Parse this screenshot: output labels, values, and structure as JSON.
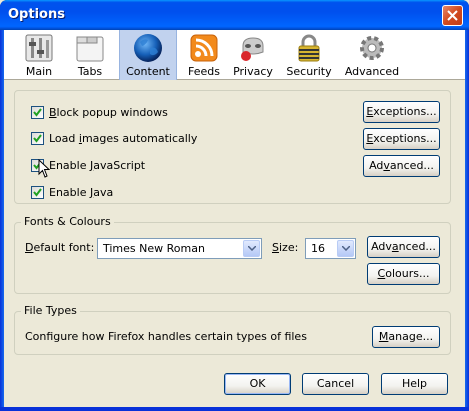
{
  "window": {
    "title": "Options"
  },
  "panes": [
    {
      "id": "main",
      "label": "Main",
      "icon": "main-settings-icon"
    },
    {
      "id": "tabs",
      "label": "Tabs",
      "icon": "tabs-icon"
    },
    {
      "id": "content",
      "label": "Content",
      "icon": "globe-icon",
      "selected": true
    },
    {
      "id": "feeds",
      "label": "Feeds",
      "icon": "feed-icon"
    },
    {
      "id": "privacy",
      "label": "Privacy",
      "icon": "privacy-mask-icon"
    },
    {
      "id": "security",
      "label": "Security",
      "icon": "padlock-icon"
    },
    {
      "id": "advanced",
      "label": "Advanced",
      "icon": "gear-icon"
    }
  ],
  "content": {
    "checkboxes": [
      {
        "label_u": "B",
        "label_rest": "lock popup windows",
        "checked": true,
        "button": "Exceptions...",
        "button_u": "E",
        "button_rest": "xceptions..."
      },
      {
        "label_pre": "Load ",
        "label_u": "i",
        "label_rest": "mages automatically",
        "checked": true,
        "button_u": "E",
        "button_rest": "xceptions..."
      },
      {
        "label_pre": "Enable ",
        "label_u": "J",
        "label_rest": "avaScript",
        "checked": true,
        "button_pre": "Ad",
        "button_u": "v",
        "button_rest": "anced..."
      },
      {
        "label_pre": "Enable ",
        "label_u": "J",
        "label_rest": "ava",
        "checked": true
      }
    ],
    "fonts": {
      "group_title": "Fonts & Colours",
      "default_font_label_pre": "",
      "default_font_label_u": "D",
      "default_font_label_rest": "efault font:",
      "default_font_value": "Times New Roman",
      "size_label_pre": "",
      "size_label_u": "S",
      "size_label_rest": "ize:",
      "size_value": "16",
      "advanced_pre": "Adv",
      "advanced_u": "a",
      "advanced_rest": "nced...",
      "colours_pre": "",
      "colours_u": "C",
      "colours_rest": "olours..."
    },
    "file_types": {
      "group_title": "File Types",
      "description": "Configure how Firefox handles certain types of files",
      "manage_pre": "",
      "manage_u": "M",
      "manage_rest": "anage..."
    }
  },
  "footer": {
    "ok": "OK",
    "cancel": "Cancel",
    "help": "Help"
  },
  "colors": {
    "titlebar": "#0054e3",
    "selected_pane": "#c1d2ee",
    "dialog_bg": "#ece9d8"
  }
}
